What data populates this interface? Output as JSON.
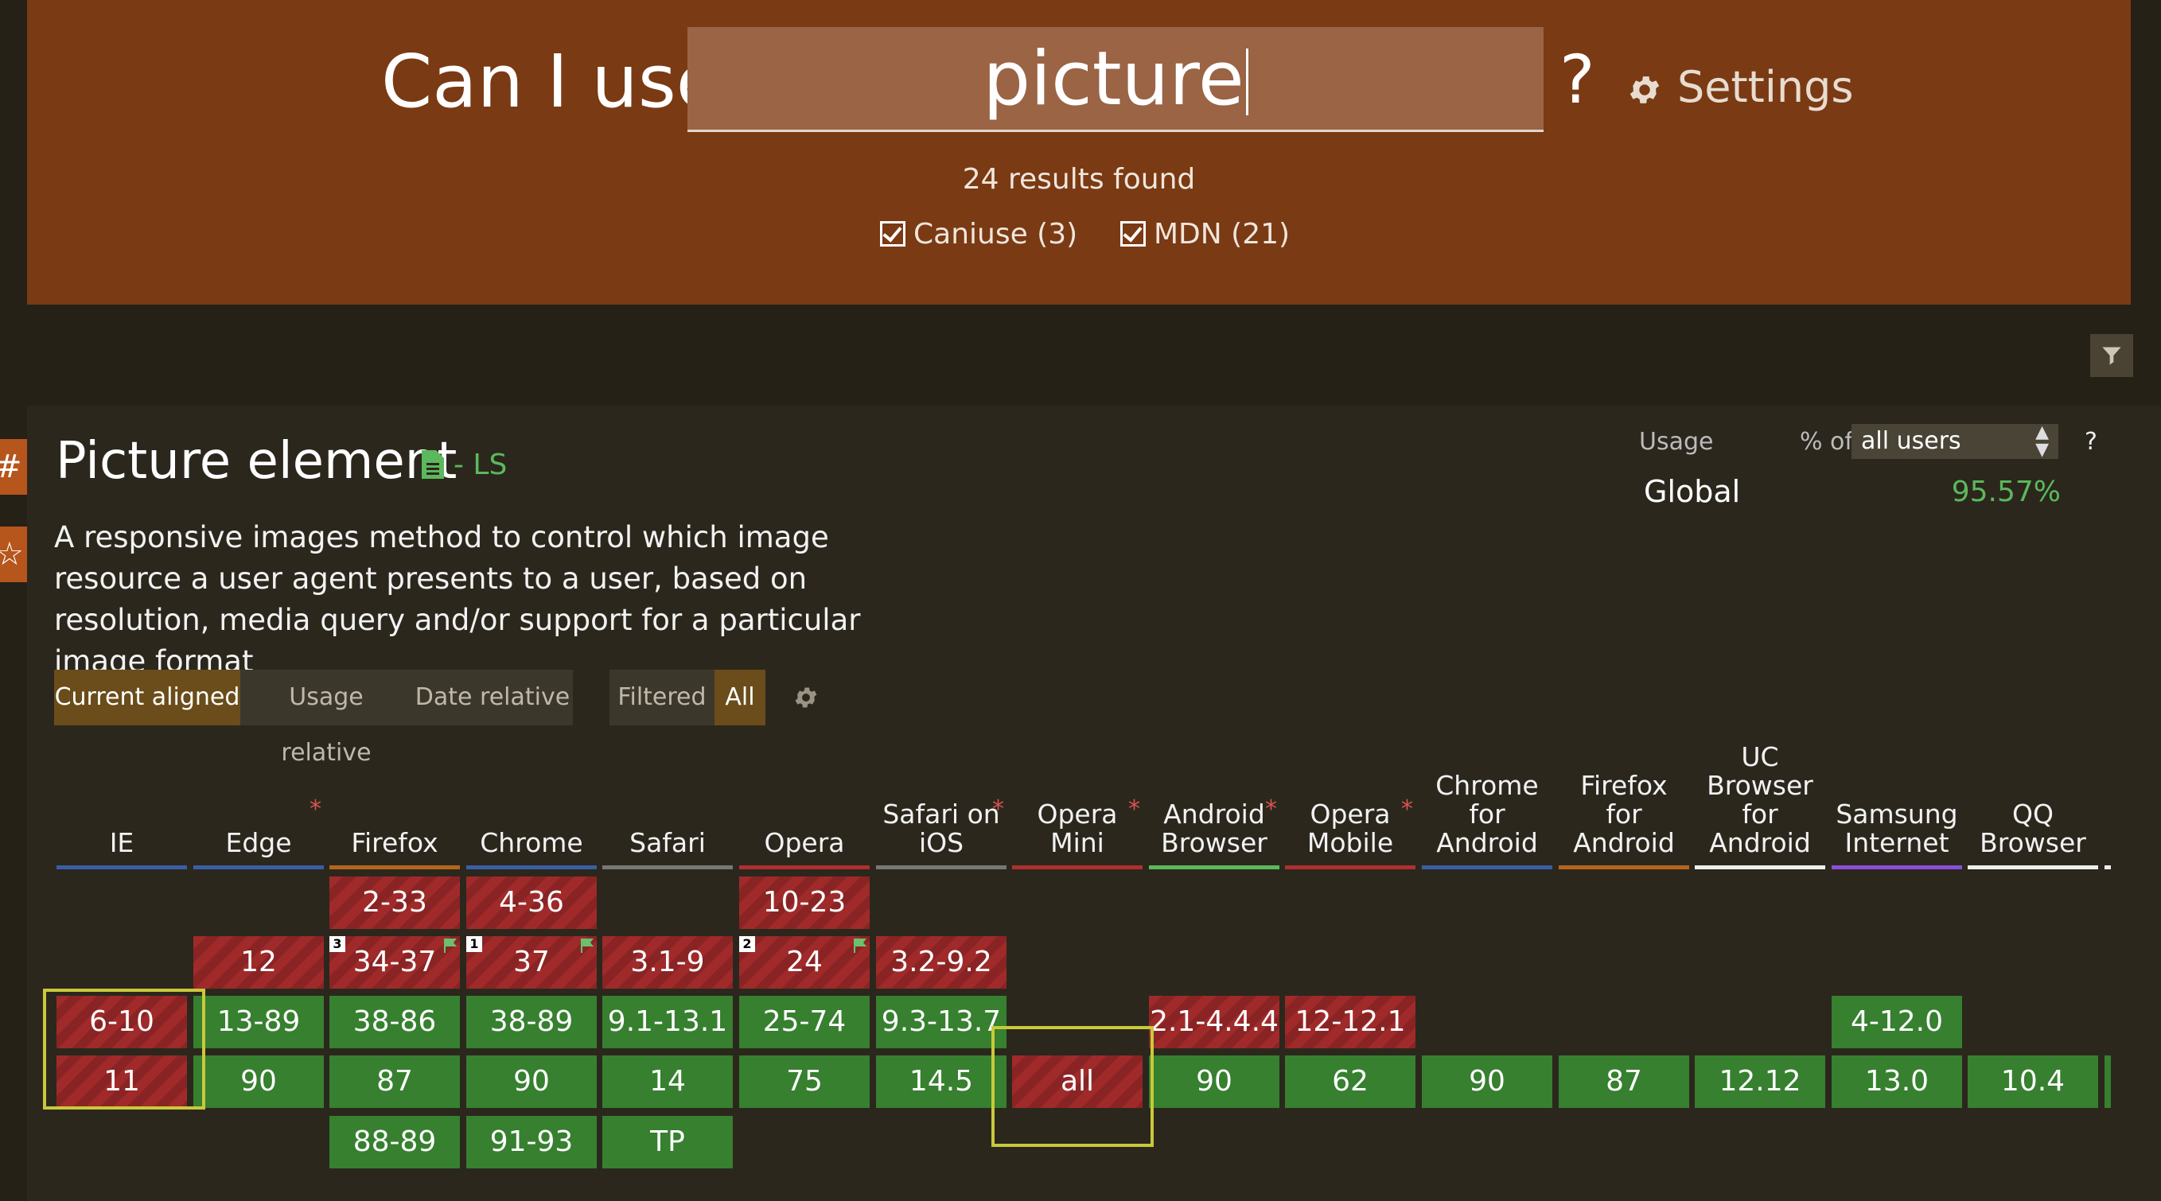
{
  "header": {
    "site_title": "Can I use",
    "search_value": "picture",
    "help": "?",
    "settings_label": "Settings",
    "results": "24 results found",
    "sources": [
      {
        "label": "Caniuse (3)"
      },
      {
        "label": "MDN (21)"
      }
    ]
  },
  "side_tabs": [
    "#",
    "☆"
  ],
  "feature": {
    "title": "Picture element",
    "status": "- LS",
    "description": "A responsive images method to control which image resource a user agent presents to a user, based on resolution, media query and/or support for a particular image format",
    "usage_label": "Usage",
    "pct_of": "% of",
    "users_select": "all users",
    "usage_help": "?",
    "global_label": "Global",
    "global_value": "95.57%"
  },
  "view_tabs": [
    "Current aligned",
    "Usage relative",
    "Date relative"
  ],
  "filter_tabs": [
    "Filtered",
    "All"
  ],
  "browsers": [
    {
      "name": "IE",
      "star": false,
      "color": "#3a5ea5",
      "rows": [
        null,
        null,
        {
          "v": "6-10",
          "s": "n"
        },
        {
          "v": "11",
          "s": "n"
        },
        null
      ]
    },
    {
      "name": "Edge",
      "star": true,
      "color": "#3a5ea5",
      "rows": [
        null,
        {
          "v": "12",
          "s": "n"
        },
        {
          "v": "13-89",
          "s": "y"
        },
        {
          "v": "90",
          "s": "y"
        },
        null
      ]
    },
    {
      "name": "Firefox",
      "star": false,
      "color": "#b5651d",
      "rows": [
        {
          "v": "2-33",
          "s": "n"
        },
        {
          "v": "34-37",
          "s": "n",
          "note": "3",
          "flag": true
        },
        {
          "v": "38-86",
          "s": "y"
        },
        {
          "v": "87",
          "s": "y"
        },
        {
          "v": "88-89",
          "s": "y"
        }
      ]
    },
    {
      "name": "Chrome",
      "star": false,
      "color": "#3a5ea5",
      "rows": [
        {
          "v": "4-36",
          "s": "n"
        },
        {
          "v": "37",
          "s": "n",
          "note": "1",
          "flag": true
        },
        {
          "v": "38-89",
          "s": "y"
        },
        {
          "v": "90",
          "s": "y"
        },
        {
          "v": "91-93",
          "s": "y"
        }
      ]
    },
    {
      "name": "Safari",
      "star": false,
      "color": "#777777",
      "rows": [
        null,
        {
          "v": "3.1-9",
          "s": "n"
        },
        {
          "v": "9.1-13.1",
          "s": "y"
        },
        {
          "v": "14",
          "s": "y"
        },
        {
          "v": "TP",
          "s": "y"
        }
      ]
    },
    {
      "name": "Opera",
      "star": false,
      "color": "#b03030",
      "rows": [
        {
          "v": "10-23",
          "s": "n"
        },
        {
          "v": "24",
          "s": "n",
          "note": "2",
          "flag": true
        },
        {
          "v": "25-74",
          "s": "y"
        },
        {
          "v": "75",
          "s": "y"
        },
        null
      ]
    },
    {
      "name": "Safari on iOS",
      "star": true,
      "color": "#777777",
      "rows": [
        null,
        {
          "v": "3.2-9.2",
          "s": "n"
        },
        {
          "v": "9.3-13.7",
          "s": "y"
        },
        {
          "v": "14.5",
          "s": "y"
        },
        null
      ]
    },
    {
      "name": "Opera Mini",
      "star": true,
      "color": "#b03030",
      "rows": [
        null,
        null,
        null,
        {
          "v": "all",
          "s": "n"
        },
        null
      ]
    },
    {
      "name": "Android Browser",
      "star": true,
      "color": "#5cb85c",
      "rows": [
        null,
        null,
        {
          "v": "2.1-4.4.4",
          "s": "n"
        },
        {
          "v": "90",
          "s": "y"
        },
        null
      ]
    },
    {
      "name": "Opera Mobile",
      "star": true,
      "color": "#b03030",
      "rows": [
        null,
        null,
        {
          "v": "12-12.1",
          "s": "n"
        },
        {
          "v": "62",
          "s": "y"
        },
        null
      ]
    },
    {
      "name": "Chrome for Android",
      "star": false,
      "color": "#3a5ea5",
      "rows": [
        null,
        null,
        null,
        {
          "v": "90",
          "s": "y"
        },
        null
      ]
    },
    {
      "name": "Firefox for Android",
      "star": false,
      "color": "#b5651d",
      "rows": [
        null,
        null,
        null,
        {
          "v": "87",
          "s": "y"
        },
        null
      ]
    },
    {
      "name": "UC Browser for Android",
      "star": false,
      "color": "#eeeeee",
      "rows": [
        null,
        null,
        null,
        {
          "v": "12.12",
          "s": "y"
        },
        null
      ]
    },
    {
      "name": "Samsung Internet",
      "star": false,
      "color": "#8a4fd8",
      "rows": [
        null,
        null,
        {
          "v": "4-12.0",
          "s": "y"
        },
        {
          "v": "13.0",
          "s": "y"
        },
        null
      ]
    },
    {
      "name": "QQ Browser",
      "star": false,
      "color": "#eeeeee",
      "rows": [
        null,
        null,
        null,
        {
          "v": "10.4",
          "s": "y"
        },
        null
      ]
    }
  ]
}
